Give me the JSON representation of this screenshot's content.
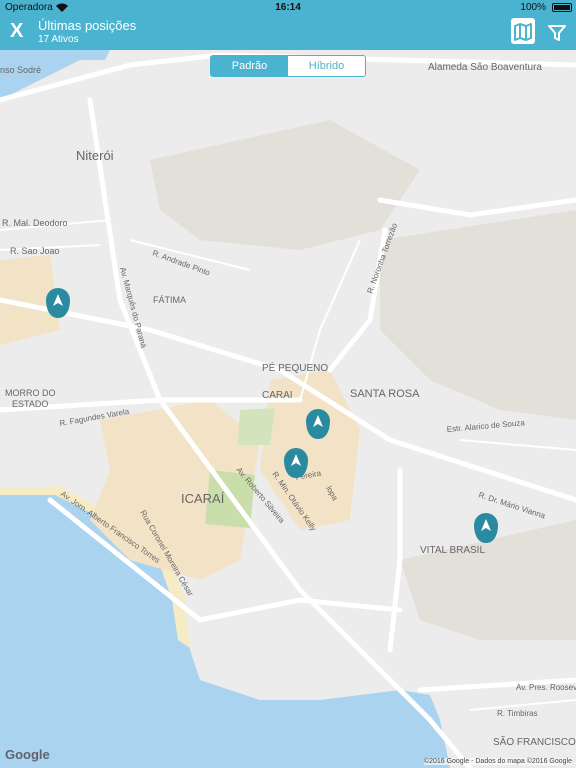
{
  "status_bar": {
    "carrier": "Operadora",
    "time": "16:14",
    "battery": "100%"
  },
  "nav": {
    "close_label": "X",
    "title": "Últimas posições",
    "subtitle": "17 Ativos",
    "map_icon": "map-icon",
    "filter_icon": "filter-icon"
  },
  "map_toggle": {
    "options": [
      "Padrão",
      "Híbrido"
    ],
    "selected": "Padrão"
  },
  "map_labels": {
    "niteroi": "Niterói",
    "sodre": "nso Sodré",
    "bvent": "Alameda São Boaventura",
    "mal_deodoro": "R. Mal. Deodoro",
    "sao_joao": "R. Sao Joao",
    "andrade_pinto": "R. Andrade Pinto",
    "marques": "Av. Marquês do Paraná",
    "fatima": "FÁTIMA",
    "noronha": "R. Noronha Torrezão",
    "morro1": "MORRO DO",
    "morro2": "ESTADO",
    "fagundes": "R. Fagundes Varela",
    "pe_pequeno": "PÉ PEQUENO",
    "carai": "CARAI",
    "santa_rosa": "SANTA ROSA",
    "alarico": "Estr. Alarico de Souza",
    "icarai": "ICARAÍ",
    "roberto": "Av. Roberto Silveira",
    "otavio": "R. Min. Otávio Kelly",
    "jornalista": "Av. Jorn. Alberto Francisco Torres",
    "coronel": "Rua Coronel Moreira César",
    "mario_vianna": "R. Dr. Mário Vianna",
    "vital_brasil": "VITAL BRASIL",
    "pres_roosevelt": "Av. Pres. Roosevel",
    "timbiras": "R. Timbiras",
    "sao_francisco": "SÃO FRANCISCO",
    "pereira": "Pereira",
    "lopa": "lopa"
  },
  "google_logo": "Google",
  "attribution": "©2016 Google - Dados do mapa ©2016 Google"
}
